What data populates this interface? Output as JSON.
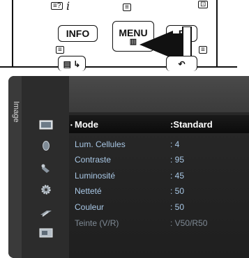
{
  "remote": {
    "buttons": {
      "info": "INFO",
      "menu": "MENU",
      "partial": "E"
    }
  },
  "osd": {
    "side_label": "Image",
    "rows": [
      {
        "label": "Mode",
        "value": ":Standard",
        "state": "selected"
      },
      {
        "label": "Lum. Cellules",
        "value": ": 4",
        "state": "normal"
      },
      {
        "label": "Contraste",
        "value": ": 95",
        "state": "normal"
      },
      {
        "label": "Luminosité",
        "value": ": 45",
        "state": "normal"
      },
      {
        "label": "Netteté",
        "value": ": 50",
        "state": "normal"
      },
      {
        "label": "Couleur",
        "value": ": 50",
        "state": "normal"
      },
      {
        "label": "Teinte (V/R)",
        "value": ": V50/R50",
        "state": "disabled"
      }
    ],
    "icons": [
      "picture-icon",
      "sound-icon",
      "channel-icon",
      "setup-icon",
      "input-icon",
      "application-icon"
    ],
    "colors": {
      "item_text": "#a9c8e6",
      "selected_text": "#ffffff",
      "disabled_text": "#7f8a95"
    }
  }
}
